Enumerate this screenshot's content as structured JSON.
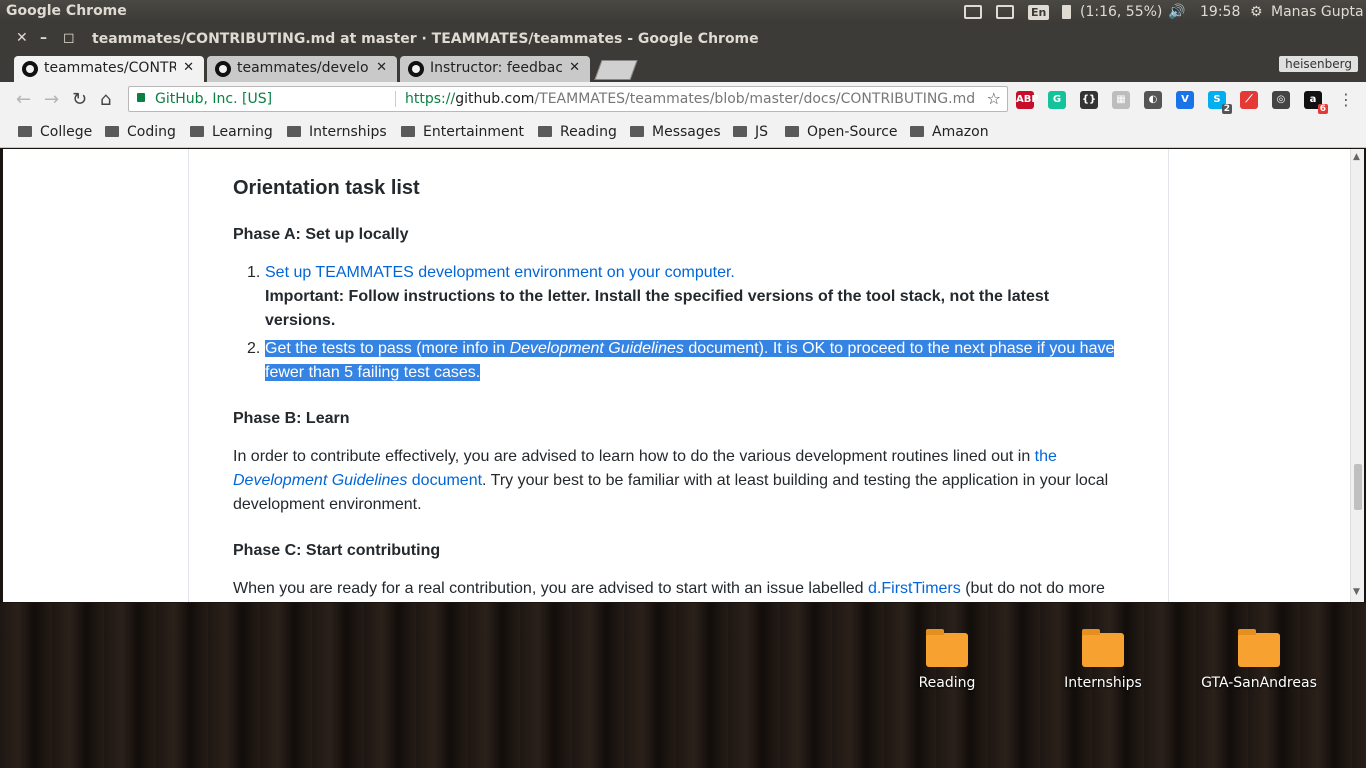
{
  "topbar": {
    "app_name": "Google Chrome",
    "lang": "En",
    "battery": "(1:16, 55%)",
    "time": "19:58",
    "user": "Manas Gupta"
  },
  "window": {
    "title": "teammates/CONTRIBUTING.md at master · TEAMMATES/teammates - Google Chrome",
    "close": "✕",
    "minimize": "–",
    "maximize": "◻"
  },
  "tabs": [
    {
      "label": "teammates/CONTRI",
      "close": "✕"
    },
    {
      "label": "teammates/develop",
      "close": "✕"
    },
    {
      "label": "Instructor: feedbac",
      "close": "✕"
    }
  ],
  "profile": "heisenberg",
  "omnibox": {
    "secure_label": "GitHub, Inc. [US]",
    "url_scheme": "https://",
    "url_domain": "github.com",
    "url_path": "/TEAMMATES/teammates/blob/master/docs/CONTRIBUTING.md"
  },
  "extensions": [
    {
      "name": "abp",
      "text": "ABP",
      "color": "#c70d2c"
    },
    {
      "name": "grammarly",
      "text": "G",
      "color": "#15c39a"
    },
    {
      "name": "json",
      "text": "{}",
      "color": "#333333"
    },
    {
      "name": "ext-generic",
      "text": "▦",
      "color": "#bdbdbd"
    },
    {
      "name": "lightbulb",
      "text": "◐",
      "color": "#555555"
    },
    {
      "name": "vimeo",
      "text": "V",
      "color": "#1a73e8"
    },
    {
      "name": "skype",
      "text": "S",
      "color": "#00aff0",
      "badge": "2"
    },
    {
      "name": "pdf",
      "text": "⟋",
      "color": "#e53935"
    },
    {
      "name": "copy",
      "text": "◎",
      "color": "#444444"
    },
    {
      "name": "amazon",
      "text": "a",
      "color": "#111111",
      "badge": "6"
    }
  ],
  "bookmarks": [
    "College",
    "Coding",
    "Learning",
    "Internships",
    "Entertainment",
    "Reading",
    "Messages",
    "JS",
    "Open-Source",
    "Amazon"
  ],
  "article": {
    "heading": "Orientation task list",
    "phase_a": "Phase A: Set up locally",
    "item1_num": "1.",
    "item1_link": "Set up TEAMMATES development environment on your computer.",
    "item1_important": "Important: Follow instructions to the letter. Install the specified versions of the tool stack, not the latest",
    "item1_important_cont": "versions.",
    "item2_num": "2.",
    "item2_part1": "Get the tests to pass (more info in ",
    "item2_italic": "Development Guidelines",
    "item2_part2": " document). It is OK to proceed to the next phase if you have",
    "item2_line2": "fewer than 5 failing test cases.",
    "phase_b": "Phase B: Learn",
    "learn_text1": "In order to contribute effectively, you are advised to learn how to do the various development routines lined out in ",
    "learn_link1": "the",
    "learn_link_italic": "Development Guidelines",
    "learn_link2": " document",
    "learn_text2": ". Try your best to be familiar with at least building and testing the application in your local",
    "learn_text3": "development environment.",
    "phase_c": "Phase C: Start contributing",
    "contrib_text1": "When you are ready for a real contribution, you are advised to start with an issue labelled ",
    "contrib_link": "d.FirstTimers",
    "contrib_text2": " (but do not do more"
  },
  "desktop_icons": [
    "Reading",
    "Internships",
    "GTA-SanAndreas"
  ]
}
